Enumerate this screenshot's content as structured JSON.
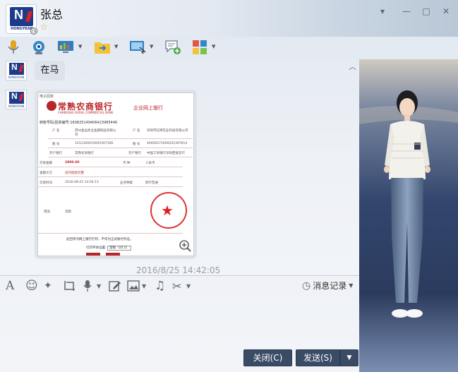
{
  "header": {
    "contact_name": "张总",
    "avatar_brand": "HONGYEAN",
    "avatar_letter": "N"
  },
  "window_controls": {
    "menu": "▾",
    "minimize": "—",
    "maximize": "□",
    "close": "✕"
  },
  "messages": [
    {
      "type": "text",
      "text": "在马"
    },
    {
      "type": "image"
    }
  ],
  "receipt": {
    "bank_name": "常熟农商银行",
    "bank_name_en": "CHANGSHU RURAL COMMERCIAL BANK",
    "subsystem": "企业网上银行",
    "header_small": "电子回单",
    "seq_label": "转帐号码/回单编号:",
    "seq_value": "160825149406423985446",
    "payer_name_label": "户 名",
    "payer_name": "苏州金远商业金属制品有限公司",
    "payer_acct_label": "账 号",
    "payer_acct": "1012300010005407186",
    "payer_bank_label": "开户银行",
    "payer_bank": "常熟农商银行",
    "payee_name_label": "户 名",
    "payee_name": "深圳市石特实业科技有限公司",
    "payee_acct_label": "账 号",
    "payee_acct": "40000271609205397814",
    "payee_bank_label": "开户银行",
    "payee_bank": "中国工商银行深圳西丽支行",
    "amount_label": "交易金额",
    "amount": "2800.00",
    "currency_label": "币 种",
    "currency": "人民币",
    "amount_words_label": "金额大写",
    "amount_words": "贰仟捌佰元整",
    "time_label": "交易时间",
    "time": "2016-08-25 14:04:13",
    "type_label": "业务种类",
    "type": "跨行普通",
    "usage_label": "用途",
    "usage": "货款",
    "footer_note": "此回单为网上银行打印，不作为正式收付凭证。",
    "print_label": "打印字体设置:",
    "print_select": "常规（10.5）"
  },
  "timestamp": "2016/8/25 14:42:05",
  "input_toolbar": {
    "history_label": "消息记录"
  },
  "buttons": {
    "close_label": "关闭(C)",
    "send_label": "发送(S)"
  },
  "colors": {
    "accent_button": "#3a4b66",
    "bank_red": "#b8262b",
    "star": "#e1a916"
  }
}
